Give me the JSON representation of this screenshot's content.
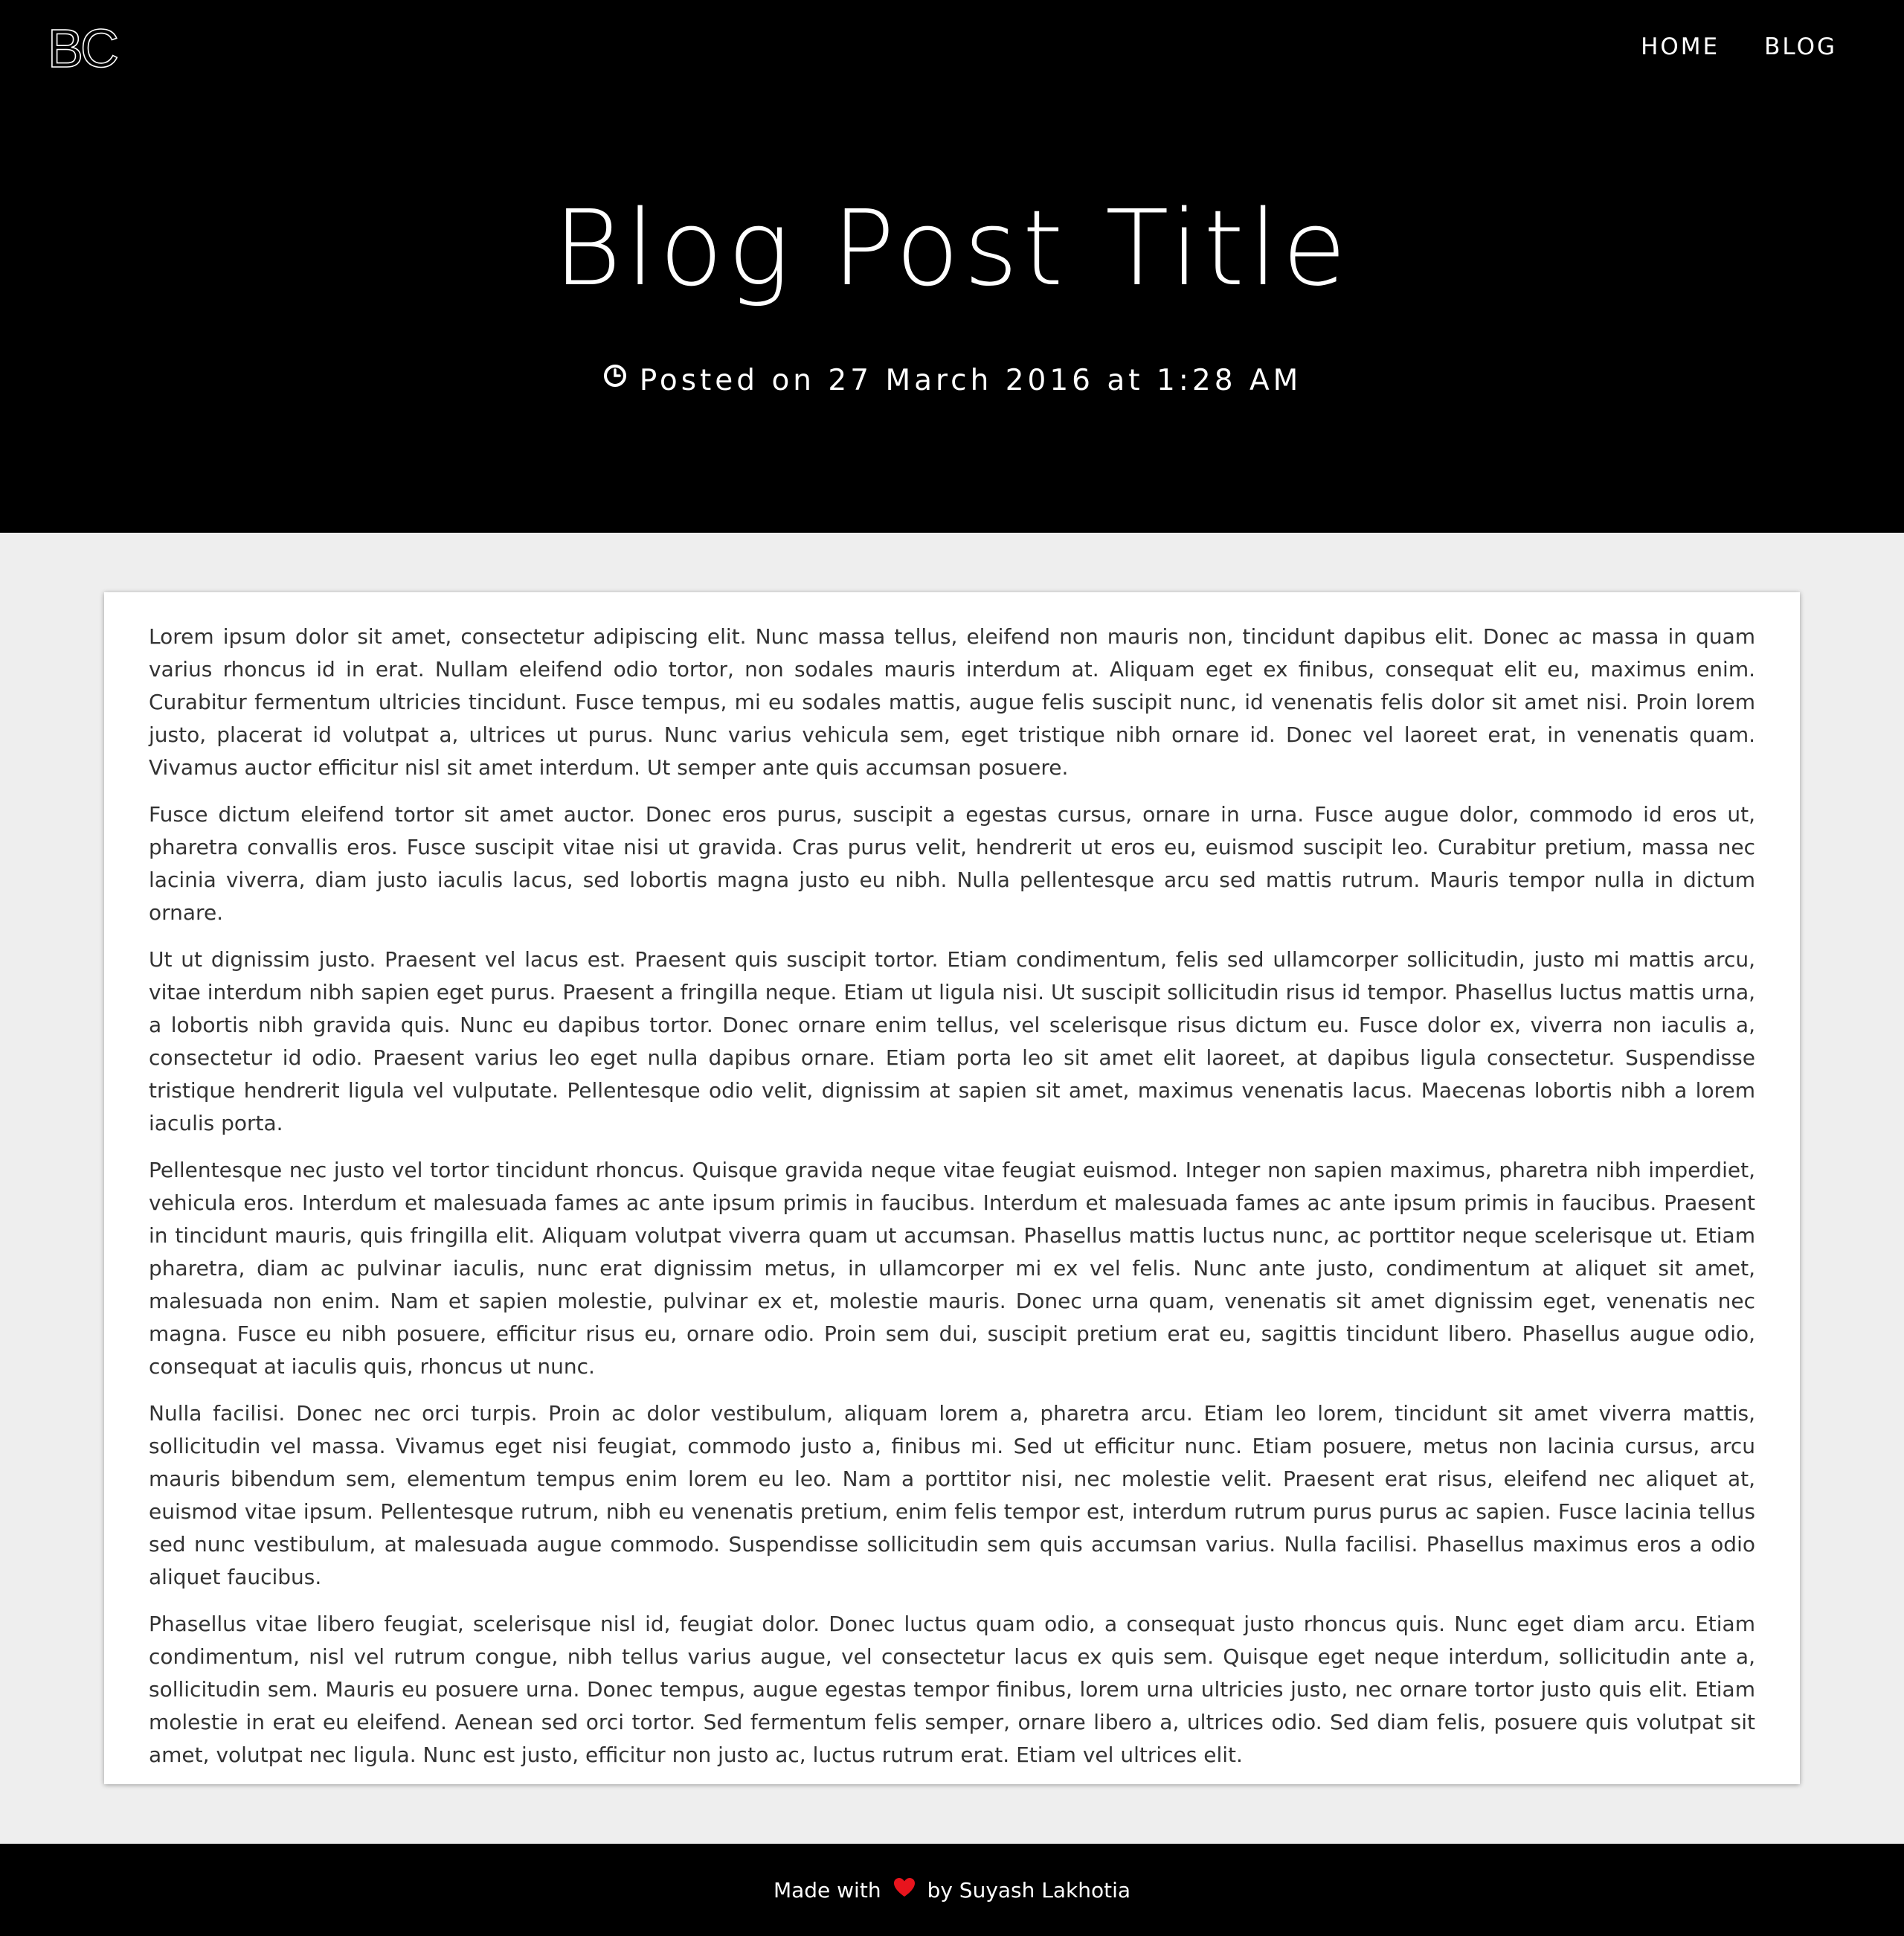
{
  "header": {
    "logo": "BC",
    "nav": [
      "HOME",
      "BLOG"
    ],
    "title": "Blog Post Title",
    "meta": "Posted on 27 March 2016 at 1:28 AM",
    "meta_icon": "clock-icon"
  },
  "post": {
    "paragraphs": [
      "Lorem ipsum dolor sit amet, consectetur adipiscing elit. Nunc massa tellus, eleifend non mauris non, tincidunt dapibus elit. Donec ac massa in quam varius rhoncus id in erat. Nullam eleifend odio tortor, non sodales mauris interdum at. Aliquam eget ex finibus, consequat elit eu, maximus enim. Curabitur fermentum ultricies tincidunt. Fusce tempus, mi eu sodales mattis, augue felis suscipit nunc, id venenatis felis dolor sit amet nisi. Proin lorem justo, placerat id volutpat a, ultrices ut purus. Nunc varius vehicula sem, eget tristique nibh ornare id. Donec vel laoreet erat, in venenatis quam. Vivamus auctor efficitur nisl sit amet interdum. Ut semper ante quis accumsan posuere.",
      "Fusce dictum eleifend tortor sit amet auctor. Donec eros purus, suscipit a egestas cursus, ornare in urna. Fusce augue dolor, commodo id eros ut, pharetra convallis eros. Fusce suscipit vitae nisi ut gravida. Cras purus velit, hendrerit ut eros eu, euismod suscipit leo. Curabitur pretium, massa nec lacinia viverra, diam justo iaculis lacus, sed lobortis magna justo eu nibh. Nulla pellentesque arcu sed mattis rutrum. Mauris tempor nulla in dictum ornare.",
      "Ut ut dignissim justo. Praesent vel lacus est. Praesent quis suscipit tortor. Etiam condimentum, felis sed ullamcorper sollicitudin, justo mi mattis arcu, vitae interdum nibh sapien eget purus. Praesent a fringilla neque. Etiam ut ligula nisi. Ut suscipit sollicitudin risus id tempor. Phasellus luctus mattis urna, a lobortis nibh gravida quis. Nunc eu dapibus tortor. Donec ornare enim tellus, vel scelerisque risus dictum eu. Fusce dolor ex, viverra non iaculis a, consectetur id odio. Praesent varius leo eget nulla dapibus ornare. Etiam porta leo sit amet elit laoreet, at dapibus ligula consectetur. Suspendisse tristique hendrerit ligula vel vulputate. Pellentesque odio velit, dignissim at sapien sit amet, maximus venenatis lacus. Maecenas lobortis nibh a lorem iaculis porta.",
      "Pellentesque nec justo vel tortor tincidunt rhoncus. Quisque gravida neque vitae feugiat euismod. Integer non sapien maximus, pharetra nibh imperdiet, vehicula eros. Interdum et malesuada fames ac ante ipsum primis in faucibus. Interdum et malesuada fames ac ante ipsum primis in faucibus. Praesent in tincidunt mauris, quis fringilla elit. Aliquam volutpat viverra quam ut accumsan. Phasellus mattis luctus nunc, ac porttitor neque scelerisque ut. Etiam pharetra, diam ac pulvinar iaculis, nunc erat dignissim metus, in ullamcorper mi ex vel felis. Nunc ante justo, condimentum at aliquet sit amet, malesuada non enim. Nam et sapien molestie, pulvinar ex et, molestie mauris. Donec urna quam, venenatis sit amet dignissim eget, venenatis nec magna. Fusce eu nibh posuere, efficitur risus eu, ornare odio. Proin sem dui, suscipit pretium erat eu, sagittis tincidunt libero. Phasellus augue odio, consequat at iaculis quis, rhoncus ut nunc.",
      "Nulla facilisi. Donec nec orci turpis. Proin ac dolor vestibulum, aliquam lorem a, pharetra arcu. Etiam leo lorem, tincidunt sit amet viverra mattis, sollicitudin vel massa. Vivamus eget nisi feugiat, commodo justo a, finibus mi. Sed ut efficitur nunc. Etiam posuere, metus non lacinia cursus, arcu mauris bibendum sem, elementum tempus enim lorem eu leo. Nam a porttitor nisi, nec molestie velit. Praesent erat risus, eleifend nec aliquet at, euismod vitae ipsum. Pellentesque rutrum, nibh eu venenatis pretium, enim felis tempor est, interdum rutrum purus purus ac sapien. Fusce lacinia tellus sed nunc vestibulum, at malesuada augue commodo. Suspendisse sollicitudin sem quis accumsan varius. Nulla facilisi. Phasellus maximus eros a odio aliquet faucibus.",
      "Phasellus vitae libero feugiat, scelerisque nisl id, feugiat dolor. Donec luctus quam odio, a consequat justo rhoncus quis. Nunc eget diam arcu. Etiam condimentum, nisl vel rutrum congue, nibh tellus varius augue, vel consectetur lacus ex quis sem. Quisque eget neque interdum, sollicitudin ante a, sollicitudin sem. Mauris eu posuere urna. Donec tempus, augue egestas tempor finibus, lorem urna ultricies justo, nec ornare tortor justo quis elit. Etiam molestie in erat eu eleifend. Aenean sed orci tortor. Sed fermentum felis semper, ornare libero a, ultrices odio. Sed diam felis, posuere quis volutpat sit amet, volutpat nec ligula. Nunc est justo, efficitur non justo ac, luctus rutrum erat. Etiam vel ultrices elit."
    ]
  },
  "footer": {
    "prefix": "Made with",
    "suffix": "by Suyash Lakhotia",
    "icon": "heart-icon",
    "heart_color": "#e8141d"
  },
  "colors": {
    "header_bg": "#000000",
    "page_bg": "#eeeeee",
    "card_bg": "#ffffff",
    "text": "#333333"
  }
}
